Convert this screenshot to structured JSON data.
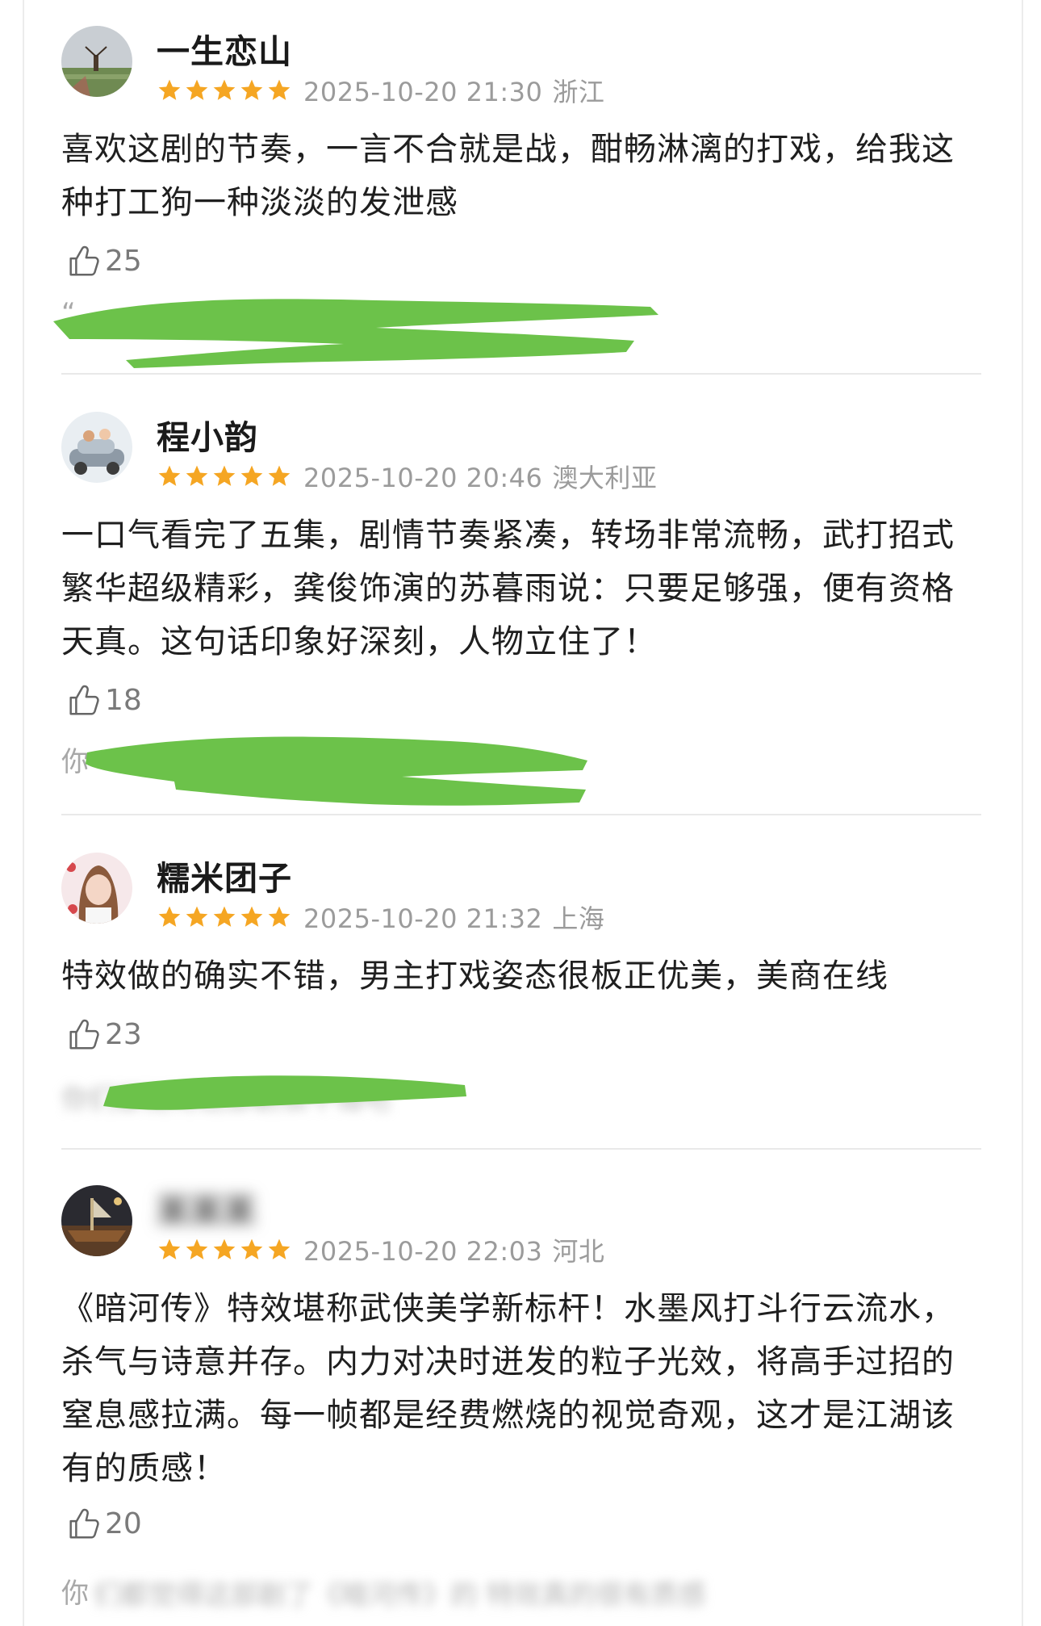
{
  "reviews": [
    {
      "username": "一生恋山",
      "rating": 5,
      "datetime": "2025-10-20 21:30",
      "location": "浙江",
      "text": "喜欢这剧的节奏，一言不合就是战，酣畅淋漓的打戏，给我这种打工狗一种淡淡的发泄感",
      "likes": "25",
      "reply_hint": "“",
      "avatar": "windmill-landscape-avatar"
    },
    {
      "username": "程小韵",
      "rating": 5,
      "datetime": "2025-10-20 20:46",
      "location": "澳大利亚",
      "text": "一口气看完了五集，剧情节奏紧凑，转场非常流畅，武打招式繁华超级精彩，龚俊饰演的苏暮雨说：只要足够强，便有资格天真。这句话印象好深刻，人物立住了！",
      "likes": "18",
      "reply_hint": "你",
      "avatar": "cartoon-car-avatar"
    },
    {
      "username": "糯米团子",
      "rating": 5,
      "datetime": "2025-10-20 21:32",
      "location": "上海",
      "text": "特效做的确实不错，男主打戏姿态很板正优美，美商在线",
      "likes": "23",
      "reply_hint": "",
      "avatar": "girl-portrait-avatar"
    },
    {
      "username": "",
      "rating": 5,
      "datetime": "2025-10-20 22:03",
      "location": "河北",
      "text": "《暗河传》特效堪称武侠美学新标杆！水墨风打斗行云流水，杀气与诗意并存。内力对决时迸发的粒子光效，将高手过招的窒息感拉满。每一帧都是经费燃烧的视觉奇观，这才是江湖该有的质感！",
      "likes": "20",
      "reply_hint": "你",
      "avatar": "ship-scene-avatar"
    }
  ],
  "colors": {
    "star": "#f5a623",
    "meta": "#9b9b9b",
    "scribble": "#6cc24a",
    "divider": "#e9e9e9"
  },
  "icons": {
    "star": "star-icon",
    "like": "thumbs-up-icon"
  }
}
